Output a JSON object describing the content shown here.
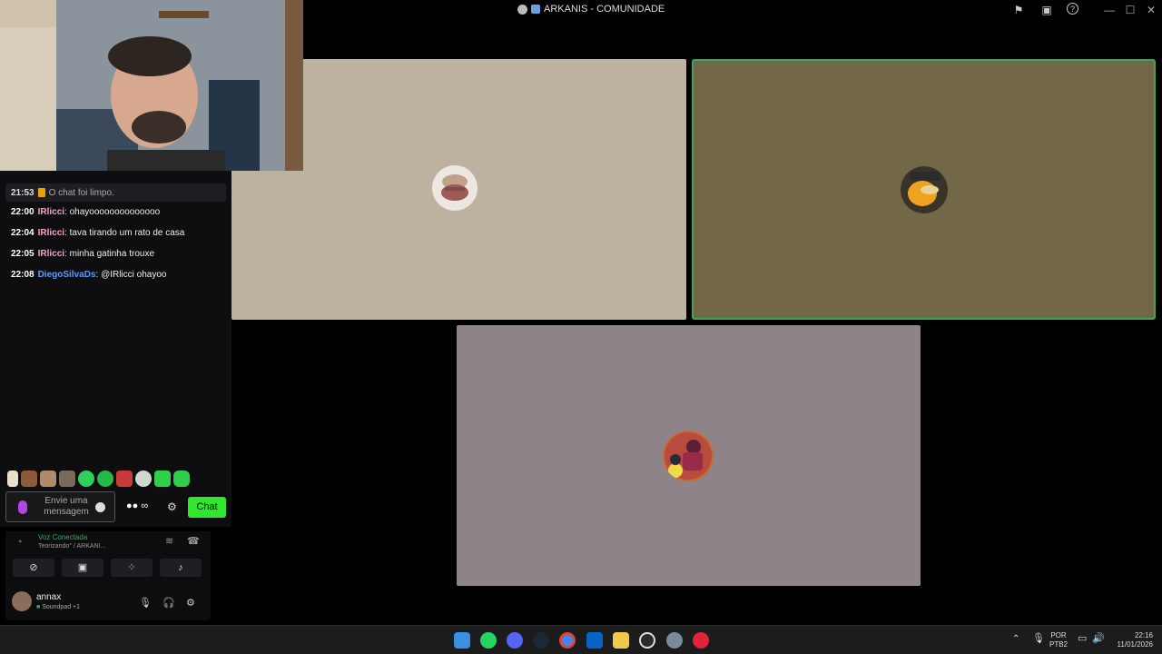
{
  "window": {
    "title": "ARKANIS - COMUNIDADE",
    "buttons": [
      "—",
      "☐",
      "✕"
    ]
  },
  "colors": {
    "tile1_bg": "#bdb2a0",
    "tile2_bg": "#726848",
    "tile2_border": "#3ba55c",
    "tile3_bg": "#8e8388",
    "chat_button": "#2ee72e",
    "username_ricci": "#ff9ec6",
    "username_diego": "#5c9cf5"
  },
  "chat": {
    "notice": {
      "time": "21:53",
      "text": "O chat foi limpo."
    },
    "messages": [
      {
        "time": "22:00",
        "user": "IRlicci",
        "text": "ohayoooooooooooooo"
      },
      {
        "time": "22:04",
        "user": "IRlicci",
        "text": "tava tirando um rato de casa"
      },
      {
        "time": "22:05",
        "user": "IRlicci",
        "text": "minha gatinha trouxe"
      },
      {
        "time": "22:08",
        "user": "DiegoSilvaDs",
        "text": "@IRlicci ohayoo"
      }
    ],
    "input_placeholder": "Envie uma mensagem",
    "points": "∞",
    "chat_button": "Chat"
  },
  "discord": {
    "voice_status": "Voz Conectada",
    "voice_channel": "Teorizando° / ARKANI...",
    "user_name": "annax",
    "user_activity": "Soundpad +1"
  },
  "tray": {
    "lang_top": "POR",
    "lang_bottom": "PTB2",
    "time": "22:16",
    "date": "11/01/2026"
  },
  "icons": {
    "title_left": "app-globe-icon",
    "title_right": [
      "flag-icon",
      "inbox-icon",
      "help-icon"
    ],
    "taskbar": [
      "windows-start-icon",
      "whatsapp-icon",
      "discord-icon",
      "steam-icon",
      "chrome-icon",
      "mail-icon",
      "file-explorer-icon",
      "obs-icon",
      "settings-icon",
      "youtube-icon"
    ]
  }
}
